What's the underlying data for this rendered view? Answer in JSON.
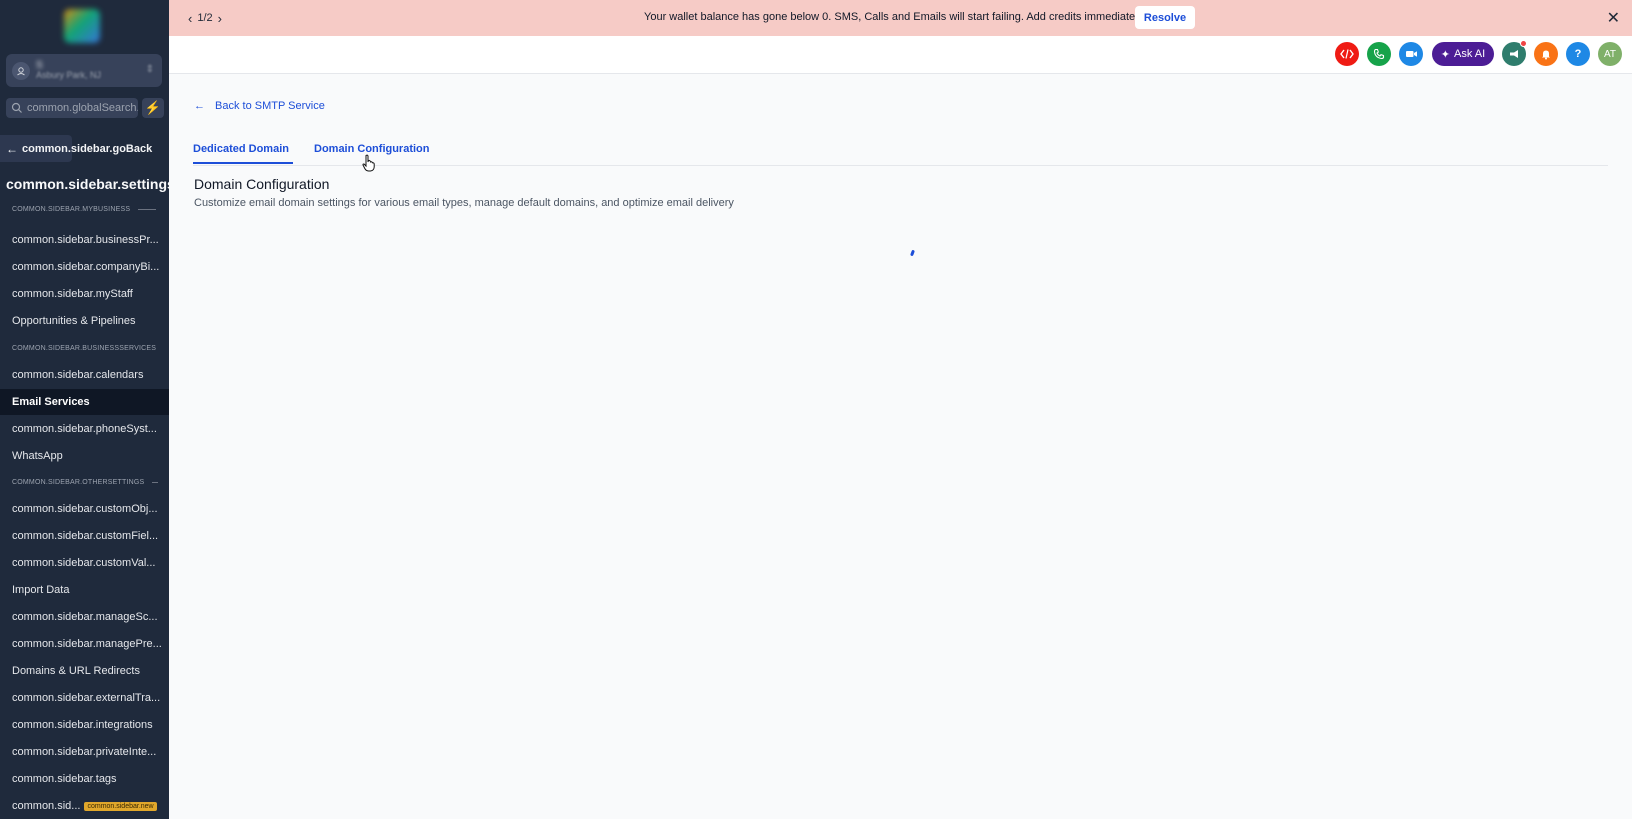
{
  "banner": {
    "pager": "1/2",
    "message": "Your wallet balance has gone below 0. SMS, Calls and Emails will start failing. Add credits immediately.",
    "resolve_label": "Resolve"
  },
  "header": {
    "ask_ai_label": "Ask AI",
    "avatar_initials": "AT",
    "help_label": "?"
  },
  "sidebar": {
    "location_name": "S",
    "location_city": "Asbury Park, NJ",
    "search_placeholder": "common.globalSearch.sidebar",
    "go_back_label": "common.sidebar.goBack",
    "settings_title": "common.sidebar.settings",
    "sections": [
      "COMMON.SIDEBAR.MYBUSINESS",
      "COMMON.SIDEBAR.BUSINESSSERVICES",
      "COMMON.SIDEBAR.OTHERSETTINGS"
    ],
    "items": [
      "common.sidebar.businessPr...",
      "common.sidebar.companyBi...",
      "common.sidebar.myStaff",
      "Opportunities & Pipelines",
      "common.sidebar.calendars",
      "Email Services",
      "common.sidebar.phoneSyst...",
      "WhatsApp",
      "common.sidebar.customObj...",
      "common.sidebar.customFiel...",
      "common.sidebar.customVal...",
      "Import Data",
      "common.sidebar.manageSc...",
      "common.sidebar.managePre...",
      "Domains & URL Redirects",
      "common.sidebar.externalTra...",
      "common.sidebar.integrations",
      "common.sidebar.privateInte...",
      "common.sidebar.tags",
      "common.sid..."
    ],
    "new_badge": "common.sidebar.new",
    "active_item": "Email Services"
  },
  "main": {
    "back_label": "Back to SMTP Service",
    "tabs": [
      "Dedicated Domain",
      "Domain Configuration"
    ],
    "active_tab": "Dedicated Domain",
    "title": "Domain Configuration",
    "subtitle": "Customize email domain settings for various email types, manage default domains, and optimize email delivery"
  },
  "colors": {
    "sidebar_bg": "#1f2a3c",
    "banner_bg": "#f6cbc6",
    "accent": "#1d4ed8",
    "ask_ai_bg": "#4c1d95"
  }
}
